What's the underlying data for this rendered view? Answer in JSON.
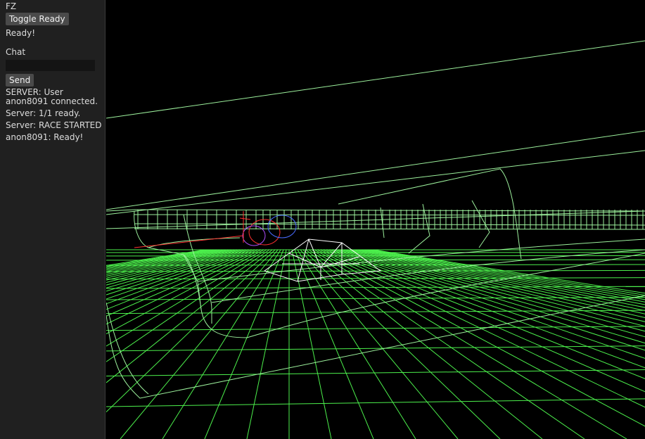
{
  "sidebar": {
    "title": "FZ",
    "toggle_ready_label": "Toggle Ready",
    "status": "Ready!",
    "chat_label": "Chat",
    "chat_input": {
      "value": "",
      "placeholder": ""
    },
    "send_label": "Send",
    "messages": [
      "SERVER: User anon8091 connected.",
      "Server: 1/1 ready.",
      "Server: RACE STARTED",
      "anon8091: Ready!"
    ]
  },
  "viewport": {
    "grid_color": "#4cf04c",
    "track_color": "#9cf09c",
    "ramp_color": "#ffffff",
    "vehicle_colors": [
      "#ff3030",
      "#4a6cff",
      "#b050ff"
    ]
  }
}
